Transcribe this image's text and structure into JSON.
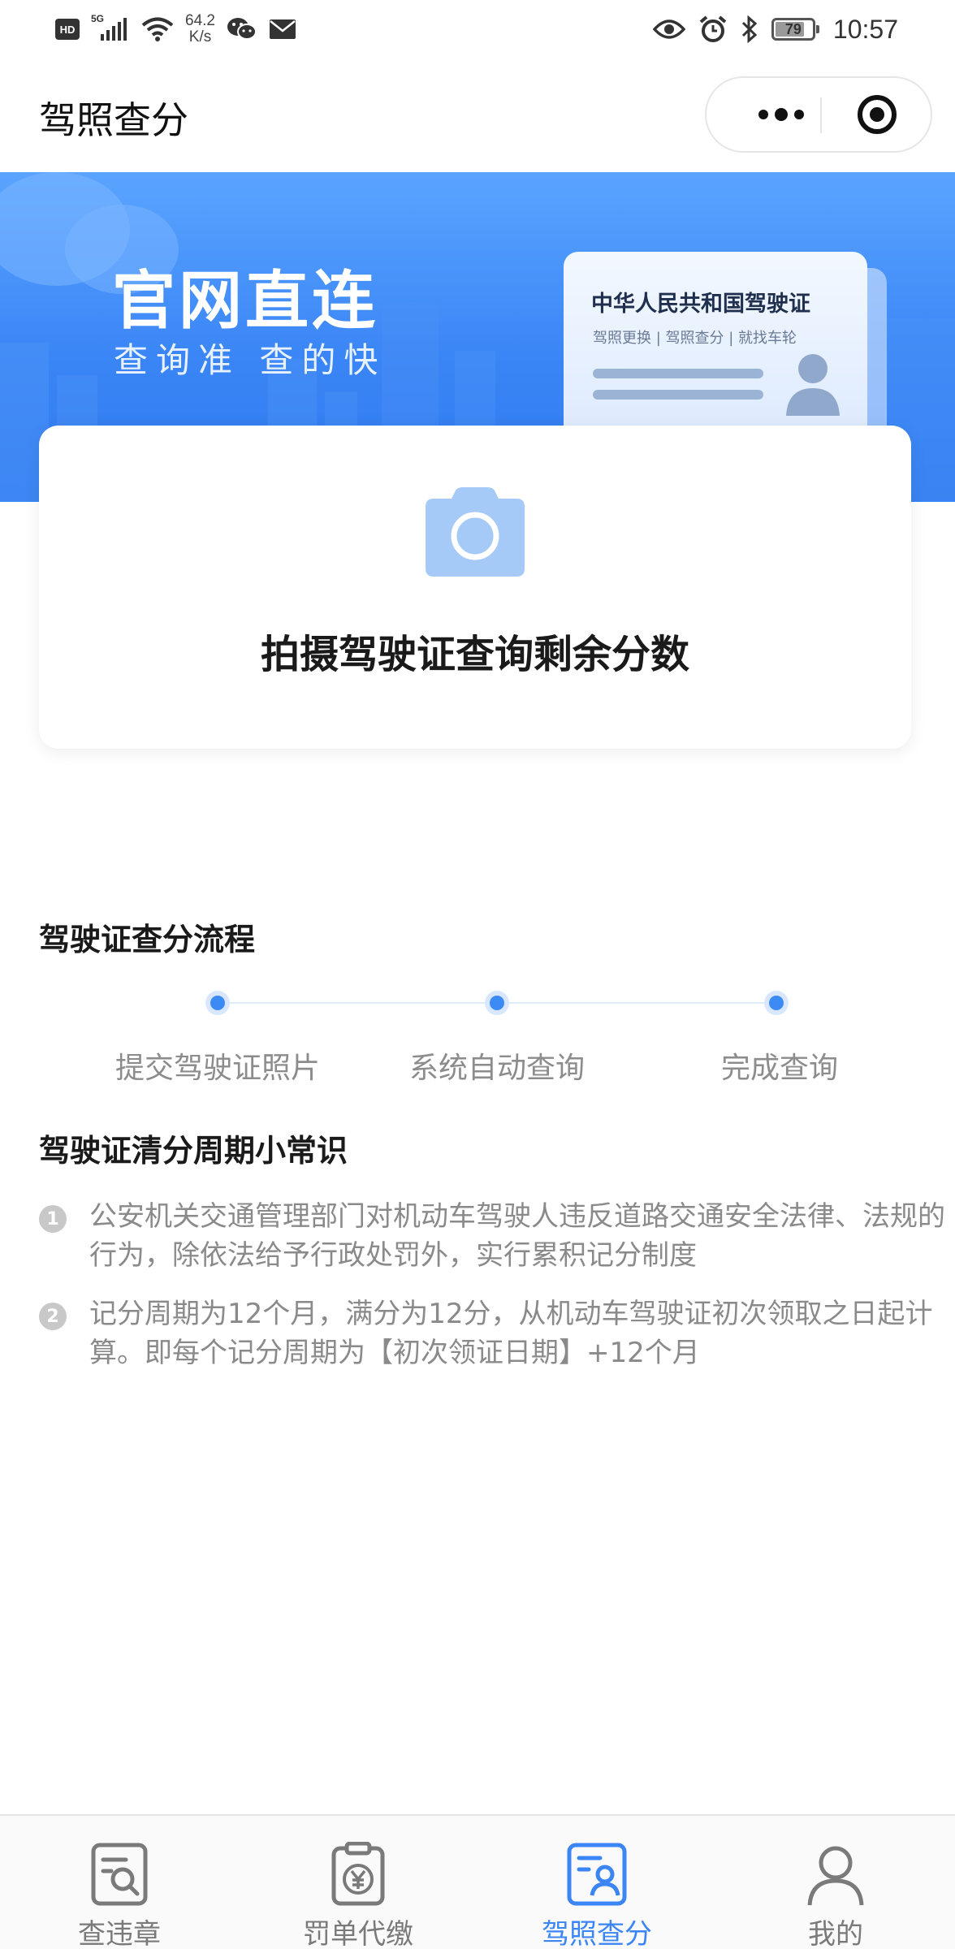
{
  "status_bar": {
    "hd": "HD",
    "network_gen": "5G",
    "net_speed_value": "64.2",
    "net_speed_unit": "K/s",
    "battery_level": "79",
    "battery_fraction": 0.79,
    "time": "10:57",
    "icons": [
      "signal-icon",
      "wifi-icon",
      "wechat-icon",
      "mail-icon",
      "eye-icon",
      "alarm-icon",
      "bluetooth-icon",
      "battery-icon"
    ]
  },
  "header": {
    "title": "驾照查分"
  },
  "banner": {
    "title": "官网直连",
    "subtitle": "查询准 查的快",
    "card_title": "中华人民共和国驾驶证",
    "card_subtitle": "驾照更换 | 驾照查分 | 就找车轮"
  },
  "photo_card": {
    "icon": "camera-icon",
    "label": "拍摄驾驶证查询剩余分数"
  },
  "process": {
    "title": "驾驶证查分流程",
    "steps": [
      {
        "label": "提交驾驶证照片"
      },
      {
        "label": "系统自动查询"
      },
      {
        "label": "完成查询"
      }
    ]
  },
  "tips": {
    "title": "驾驶证清分周期小常识",
    "items": [
      {
        "num": "1",
        "text": "公安机关交通管理部门对机动车驾驶人违反道路交通安全法律、法规的行为，除依法给予行政处罚外，实行累积记分制度"
      },
      {
        "num": "2",
        "text": "记分周期为12个月，满分为12分，从机动车驾驶证初次领取之日起计算。即每个记分周期为【初次领证日期】+12个月"
      }
    ]
  },
  "tabbar": {
    "active": 2,
    "active_color": "#3b86f4",
    "tabs": [
      {
        "label": "查违章",
        "icon": "search-document-icon"
      },
      {
        "label": "罚单代缴",
        "icon": "yuan-clipboard-icon"
      },
      {
        "label": "驾照查分",
        "icon": "license-card-icon"
      },
      {
        "label": "我的",
        "icon": "user-icon"
      }
    ]
  },
  "colors": {
    "primary": "#3b86f4",
    "banner_top": "#5aa4ff",
    "banner_bottom": "#2e79ef",
    "step_dot": "#3c8bf4"
  }
}
